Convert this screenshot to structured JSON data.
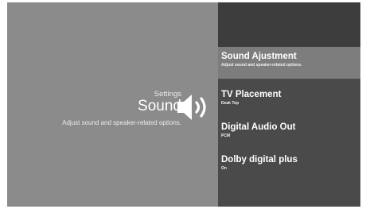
{
  "info_panel": {
    "breadcrumb": "Settings",
    "title": "Sound",
    "description": "Adjust sound and speaker-related options.",
    "icon": "speaker-icon"
  },
  "menu": {
    "items": [
      {
        "label": "Sound Ajustment",
        "sub": "Adjust sound and speaker-related options.",
        "selected": true
      },
      {
        "label": "TV Placement",
        "sub": "Deak Top",
        "selected": false
      },
      {
        "label": "Digital Audio Out",
        "sub": "PCM",
        "selected": false
      },
      {
        "label": "Dolby digital plus",
        "sub": "On",
        "selected": false
      }
    ]
  },
  "colors": {
    "background": "#8b8b8b",
    "menu_background": "#4a4a4a",
    "menu_header": "#3d3d3d",
    "selected_item": "#7d7d7d",
    "text": "#ffffff"
  }
}
